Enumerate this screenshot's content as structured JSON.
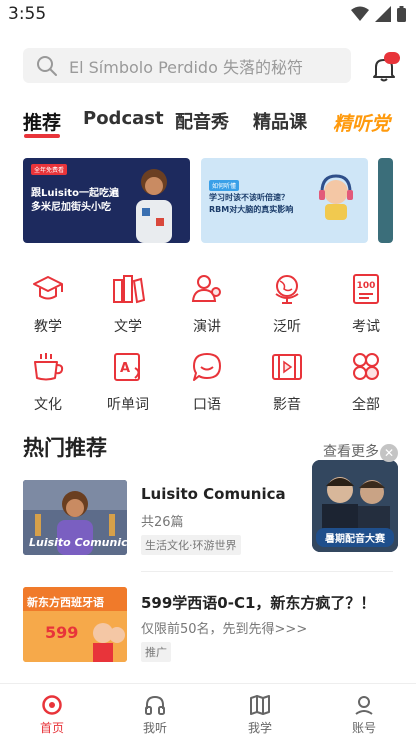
{
  "status": {
    "time": "3:55"
  },
  "search": {
    "placeholder": "El Símbolo Perdido 失落的秘符"
  },
  "tabs": [
    {
      "label": "推荐"
    },
    {
      "label": "Podcast"
    },
    {
      "label": "配音秀"
    },
    {
      "label": "精品课"
    },
    {
      "label": "精听党"
    }
  ],
  "banners": [
    {
      "tag": "全年免费看",
      "line1": "跟Luisito一起吃遍",
      "line2": "多米尼加街头小吃"
    },
    {
      "tag": "如何听懂",
      "line1": "学习时该不该听倍速？",
      "line2": "RBM对大脑的真实影响"
    }
  ],
  "categories": [
    {
      "label": "教学",
      "icon": "graduation-cap-icon"
    },
    {
      "label": "文学",
      "icon": "books-icon"
    },
    {
      "label": "演讲",
      "icon": "speaker-icon"
    },
    {
      "label": "泛听",
      "icon": "globe-icon"
    },
    {
      "label": "考试",
      "icon": "exam-100-icon"
    },
    {
      "label": "文化",
      "icon": "coffee-cup-icon"
    },
    {
      "label": "听单词",
      "icon": "word-card-icon"
    },
    {
      "label": "口语",
      "icon": "chat-bubble-icon"
    },
    {
      "label": "影音",
      "icon": "film-icon"
    },
    {
      "label": "全部",
      "icon": "grid-all-icon"
    }
  ],
  "hot": {
    "title": "热门推荐",
    "more": "查看更多",
    "items": [
      {
        "title": "Luisito Comunica",
        "sub": "共26篇",
        "chip": "生活文化·环游世界",
        "thumb_text": "Luisito Comunica"
      },
      {
        "title": "599学西语0-C1，新东方疯了？！",
        "sub": "仅限前50名，先到先得>>>",
        "chip": "推广",
        "thumb_text": "新东方西班牙语",
        "thumb_price": "599"
      }
    ]
  },
  "float_ad": {
    "label": "暑期配音大赛"
  },
  "bottom_nav": [
    {
      "label": "首页",
      "icon": "home-icon"
    },
    {
      "label": "我听",
      "icon": "headphones-icon"
    },
    {
      "label": "我学",
      "icon": "book-icon"
    },
    {
      "label": "账号",
      "icon": "account-icon"
    }
  ],
  "colors": {
    "accent": "#e8343a",
    "special_tab": "#ff9a0d"
  }
}
